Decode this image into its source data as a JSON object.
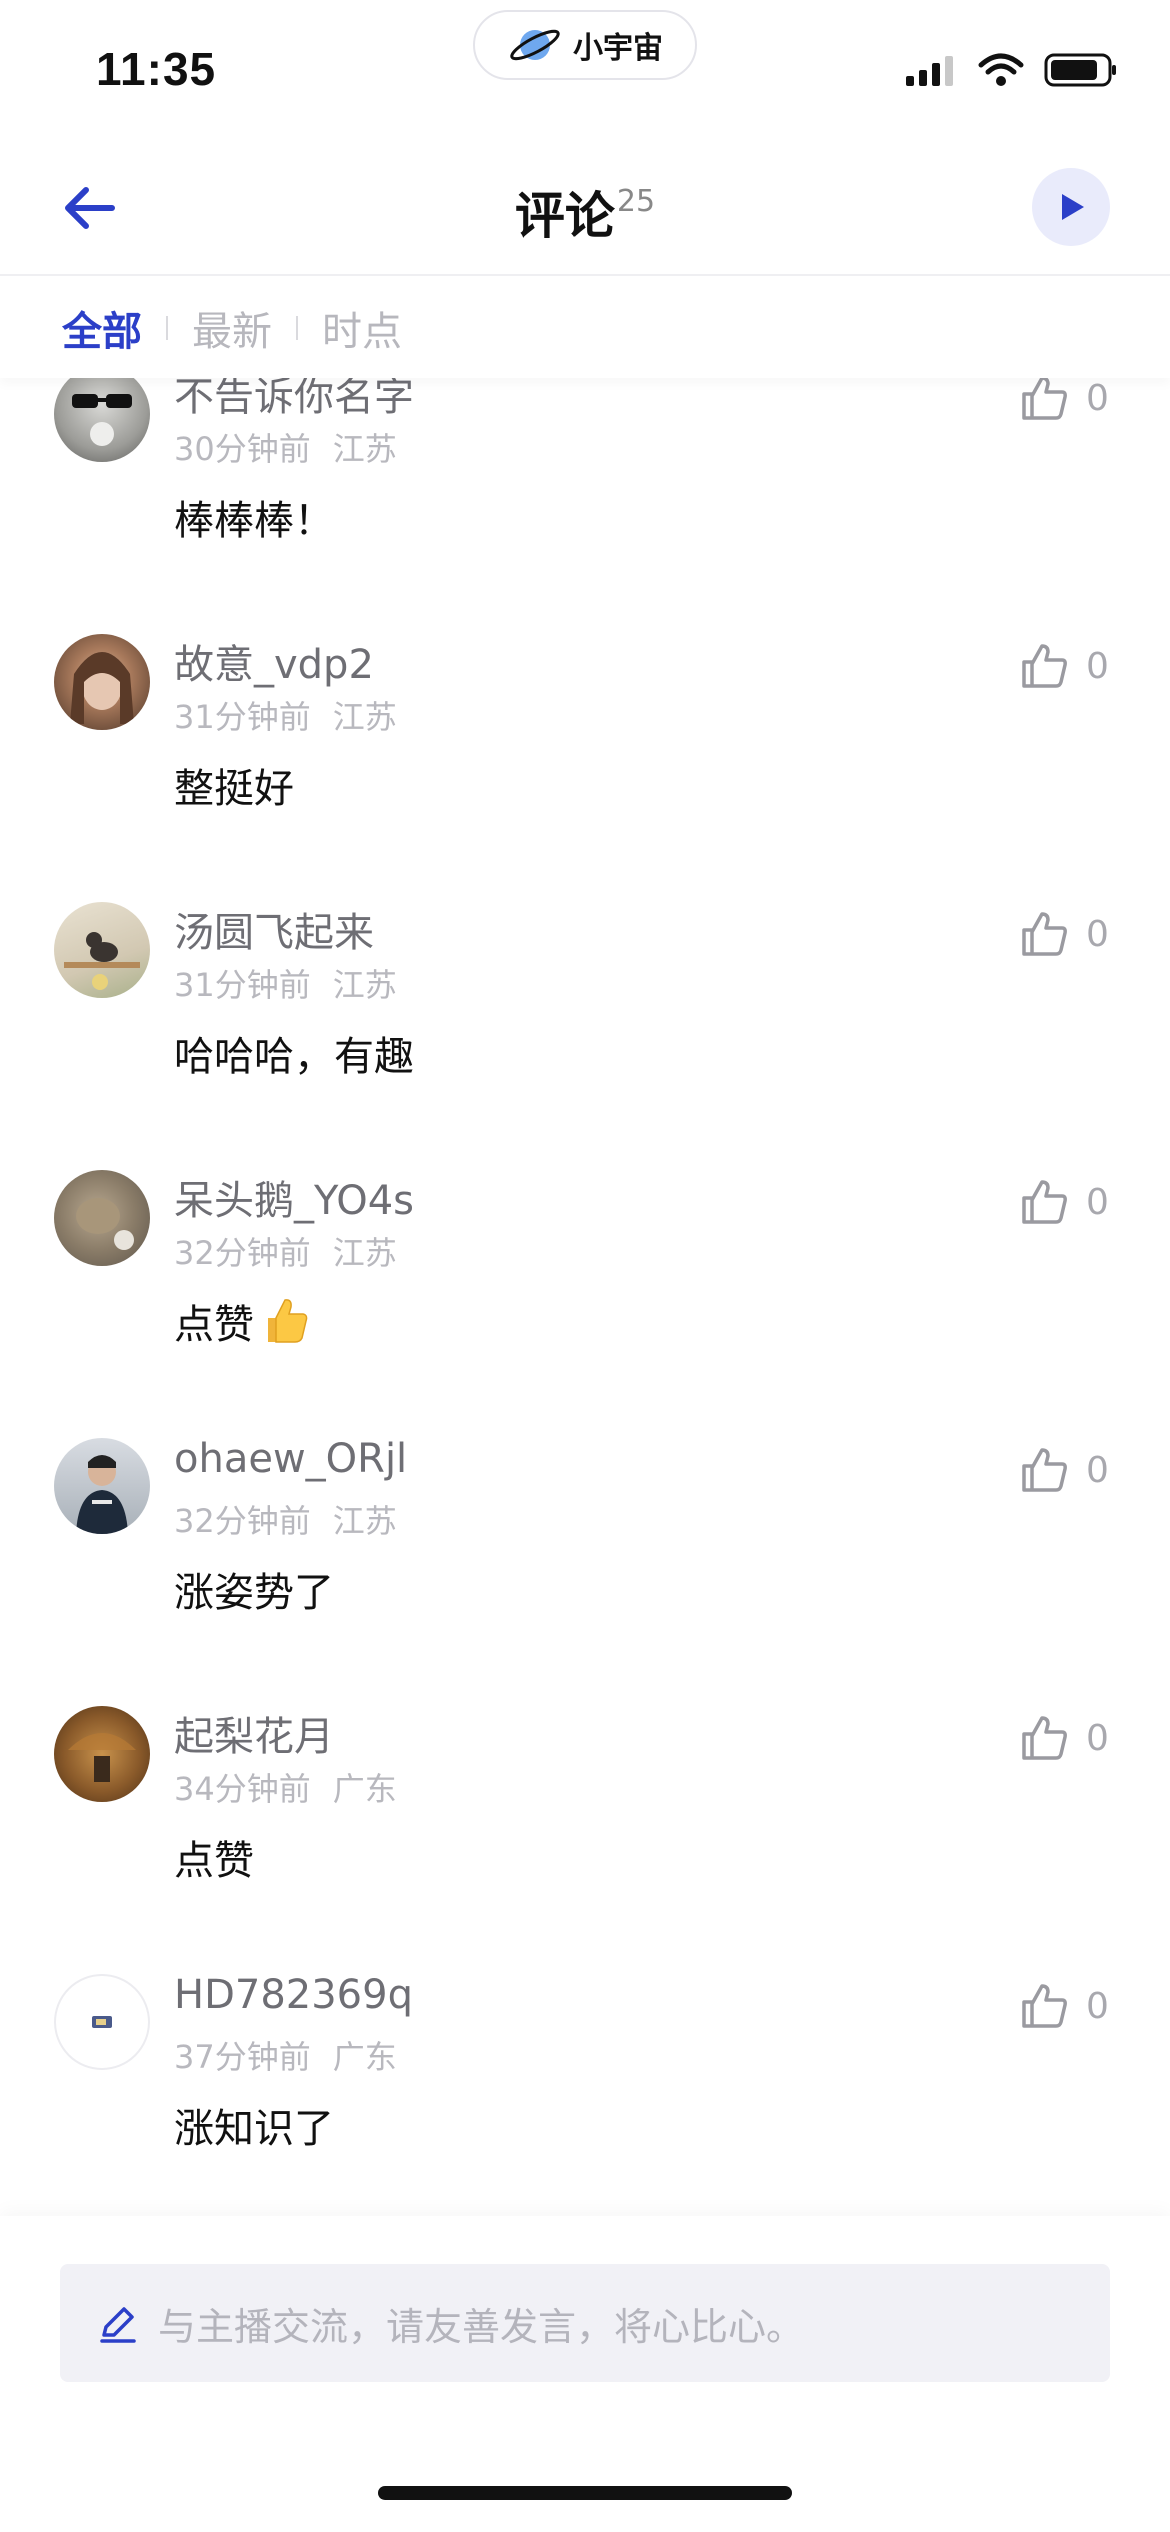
{
  "status_bar": {
    "time": "11:35",
    "app_pill_label": "小宇宙"
  },
  "header": {
    "title": "评论",
    "count": "25"
  },
  "tabs": [
    {
      "label": "全部",
      "active": true
    },
    {
      "label": "最新",
      "active": false
    },
    {
      "label": "时点",
      "active": false
    }
  ],
  "comments": [
    {
      "username": "不告诉你名字",
      "time": "30分钟前",
      "location": "江苏",
      "text": "棒棒棒！",
      "likes": "0",
      "has_emoji": false
    },
    {
      "username": "故意_vdp2",
      "time": "31分钟前",
      "location": "江苏",
      "text": "整挺好",
      "likes": "0",
      "has_emoji": false
    },
    {
      "username": "汤圆飞起来",
      "time": "31分钟前",
      "location": "江苏",
      "text": "哈哈哈，有趣",
      "likes": "0",
      "has_emoji": false
    },
    {
      "username": "呆头鹅_YO4s",
      "time": "32分钟前",
      "location": "江苏",
      "text": "点赞",
      "likes": "0",
      "has_emoji": true
    },
    {
      "username": "ohaew_ORjl",
      "time": "32分钟前",
      "location": "江苏",
      "text": "涨姿势了",
      "likes": "0",
      "has_emoji": false
    },
    {
      "username": "起梨花月",
      "time": "34分钟前",
      "location": "广东",
      "text": "点赞",
      "likes": "0",
      "has_emoji": false
    },
    {
      "username": "HD782369q",
      "time": "37分钟前",
      "location": "广东",
      "text": "涨知识了",
      "likes": "0",
      "has_emoji": false
    }
  ],
  "input": {
    "placeholder": "与主播交流，请友善发言，将心比心。"
  },
  "icons": {
    "back": "arrow-left-icon",
    "play": "play-icon",
    "like": "thumbs-up-icon",
    "edit": "pencil-icon",
    "emoji": "thumbs-up-emoji"
  },
  "colors": {
    "accent": "#2b3fc8",
    "play_bg": "#e9ebfb",
    "muted_text": "#b8b8be",
    "input_bg": "#f1f1f6"
  }
}
